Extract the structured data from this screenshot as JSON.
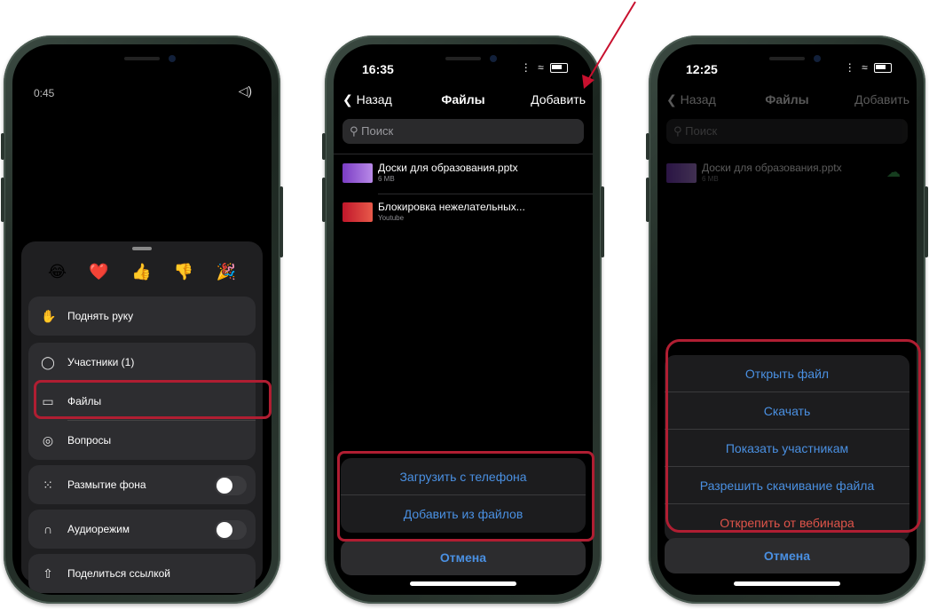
{
  "phone1": {
    "call_time": "0:45",
    "emojis": [
      "😂",
      "❤️",
      "👍",
      "👎",
      "🎉"
    ],
    "menu": [
      {
        "icon": "hand-icon",
        "glyph": "✋",
        "label": "Поднять руку"
      },
      {
        "icon": "person-icon",
        "glyph": "👤",
        "label": "Участники (1)"
      },
      {
        "icon": "folder-icon",
        "glyph": "▭",
        "label": "Файлы"
      },
      {
        "icon": "question-icon",
        "glyph": "◌",
        "label": "Вопросы"
      },
      {
        "icon": "blur-icon",
        "glyph": "⁙",
        "label": "Размытие фона"
      },
      {
        "icon": "headphones-icon",
        "glyph": "🎧",
        "label": "Аудиорежим"
      },
      {
        "icon": "share-icon",
        "glyph": "⇪",
        "label": "Поделиться ссылкой"
      }
    ]
  },
  "phone2": {
    "time": "16:35",
    "back_label": "Назад",
    "title": "Файлы",
    "add_label": "Добавить",
    "search_placeholder": "Поиск",
    "files": [
      {
        "name": "Доски для образования.pptx",
        "sub": "6 MB"
      },
      {
        "name": "Блокировка нежелательных...",
        "sub": "Youtube"
      }
    ],
    "actions": [
      "Загрузить с телефона",
      "Добавить из файлов"
    ],
    "cancel": "Отмена"
  },
  "phone3": {
    "time": "12:25",
    "back_label": "Назад",
    "title": "Файлы",
    "add_label": "Добавить",
    "search_placeholder": "Поиск",
    "file": {
      "name": "Доски для образования.pptx",
      "sub": "6 MB"
    },
    "actions": [
      "Открыть файл",
      "Скачать",
      "Показать участникам",
      "Разрешить скачивание файла",
      "Открепить от вебинара"
    ],
    "cancel": "Отмена"
  },
  "colors": {
    "accent": "#4a90e2",
    "destructive": "#e0544a",
    "highlight": "#b01e32"
  }
}
